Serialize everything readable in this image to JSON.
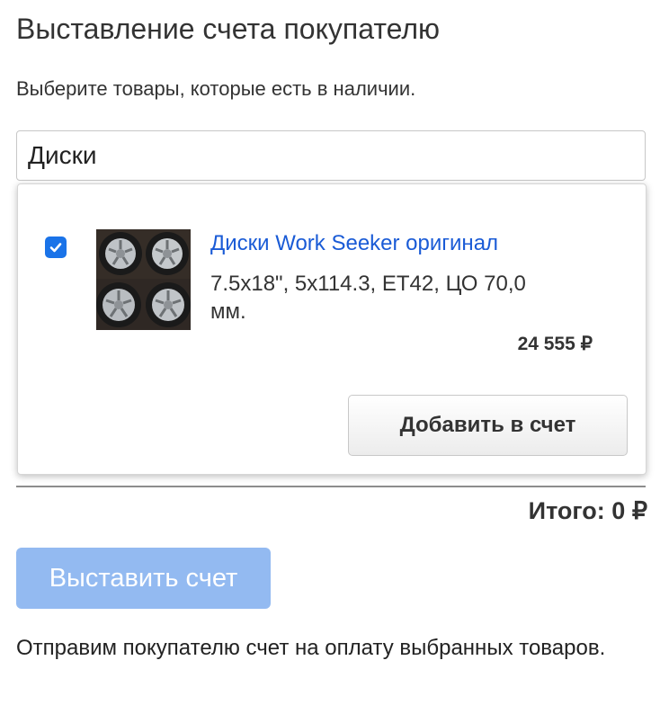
{
  "page": {
    "title": "Выставление счета покупателю",
    "subtitle": "Выберите товары, которые есть в наличии."
  },
  "search": {
    "value": "Диски",
    "placeholder": ""
  },
  "results": [
    {
      "checked": true,
      "icon": "checkmark-icon",
      "image": "wheels-photo",
      "name": "Диски Work Seeker оригинал",
      "description": "7.5x18\", 5x114.3, ET42, ЦО 70,0 мм.",
      "price": "24 555 ₽"
    }
  ],
  "dropdown": {
    "add_label": "Добавить в счет"
  },
  "summary": {
    "total": "Итого: 0 ₽"
  },
  "actions": {
    "submit_label": "Выставить счет",
    "submit_enabled": false
  },
  "footer": {
    "note": "Отправим покупателю счет на оплату выбранных товаров."
  },
  "colors": {
    "link": "#1a5bd6",
    "checkbox": "#1a73e8",
    "submit_disabled": "#93baf1"
  }
}
